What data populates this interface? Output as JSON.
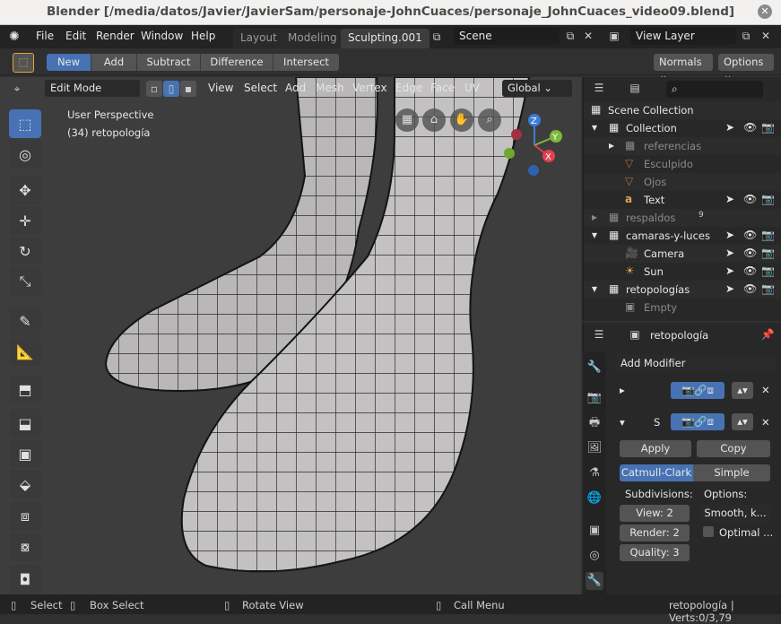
{
  "window": {
    "title": "Blender [/media/datos/Javier/JavierSam/personaje-JohnCuaces/personaje_JohnCuaces_video09.blend]"
  },
  "menu": {
    "items": [
      "File",
      "Edit",
      "Render",
      "Window",
      "Help"
    ],
    "tabs": [
      "Layout",
      "Modeling",
      "Sculpting.001"
    ],
    "scene": "Scene",
    "view_layer": "View Layer"
  },
  "tool_header": {
    "modes": [
      "New",
      "Add",
      "Subtract",
      "Difference",
      "Intersect"
    ],
    "normals": "Normals",
    "options": "Options"
  },
  "viewport_header": {
    "mode": "Edit Mode",
    "menus": [
      "View",
      "Select",
      "Add",
      "Mesh",
      "Vertex",
      "Edge",
      "Face",
      "UV"
    ],
    "transform": "Global"
  },
  "viewport": {
    "perspective": "User Perspective",
    "object_info": "(34) retopología"
  },
  "gizmo": {
    "x": "X",
    "y": "Y",
    "z": "Z"
  },
  "outliner": {
    "rows": [
      {
        "label": "Scene Collection"
      },
      {
        "label": "Collection"
      },
      {
        "label": "referencias"
      },
      {
        "label": "Esculpido"
      },
      {
        "label": "Ojos"
      },
      {
        "label": "Text"
      },
      {
        "label": "respaldos",
        "badge": "9"
      },
      {
        "label": "camaras-y-luces"
      },
      {
        "label": "Camera"
      },
      {
        "label": "Sun"
      },
      {
        "label": "retopologías"
      },
      {
        "label": "Empty"
      }
    ]
  },
  "properties": {
    "object_name": "retopología",
    "add_modifier": "Add Modifier",
    "modifier2_initial": "S",
    "apply": "Apply",
    "copy": "Copy",
    "types": [
      "Catmull-Clark",
      "Simple"
    ],
    "subdivisions_label": "Subdivisions:",
    "options_label": "Options:",
    "view": "View:",
    "view_val": "2",
    "render": "Render:",
    "render_val": "2",
    "quality": "Quality:",
    "quality_val": "3",
    "uv_smooth": "Smooth, k...",
    "optimal": "Optimal ..."
  },
  "status": {
    "select": "Select",
    "box_select": "Box Select",
    "rotate_view": "Rotate View",
    "call_menu": "Call Menu",
    "stats": "retopología | Verts:0/3,79"
  },
  "colors": {
    "accent": "#4772b3",
    "bg": "#303030",
    "viewport": "#3d3d3d"
  }
}
